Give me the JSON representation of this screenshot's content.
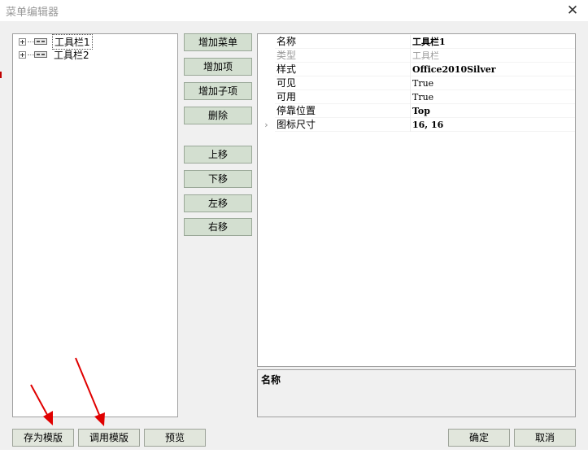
{
  "window": {
    "title": "菜单编辑器",
    "close_label": "✕"
  },
  "tree": {
    "items": [
      {
        "label": "工具栏1",
        "selected": true
      },
      {
        "label": "工具栏2",
        "selected": false
      }
    ]
  },
  "actions": {
    "add_menu": "增加菜单",
    "add_item": "增加项",
    "add_subitem": "增加子项",
    "delete": "删除",
    "move_up": "上移",
    "move_down": "下移",
    "move_left": "左移",
    "move_right": "右移"
  },
  "properties": [
    {
      "name": "名称",
      "value": "工具栏1",
      "bold": true,
      "disabled": false,
      "expandable": false
    },
    {
      "name": "类型",
      "value": "工具栏",
      "bold": false,
      "disabled": true,
      "expandable": false
    },
    {
      "name": "样式",
      "value": "Office2010Silver",
      "bold": true,
      "disabled": false,
      "expandable": false
    },
    {
      "name": "可见",
      "value": "True",
      "bold": false,
      "disabled": false,
      "expandable": false
    },
    {
      "name": "可用",
      "value": "True",
      "bold": false,
      "disabled": false,
      "expandable": false
    },
    {
      "name": "停靠位置",
      "value": "Top",
      "bold": true,
      "disabled": false,
      "expandable": false
    },
    {
      "name": "图标尺寸",
      "value": "16, 16",
      "bold": true,
      "disabled": false,
      "expandable": true
    }
  ],
  "description": {
    "title": "名称"
  },
  "footer": {
    "save_template": "存为模版",
    "load_template": "调用模版",
    "preview": "预览",
    "ok": "确定",
    "cancel": "取消"
  },
  "colors": {
    "arrow": "#e00000",
    "button_bg": "#d3dfd0"
  },
  "icons": {
    "expand_arrow": "›"
  }
}
